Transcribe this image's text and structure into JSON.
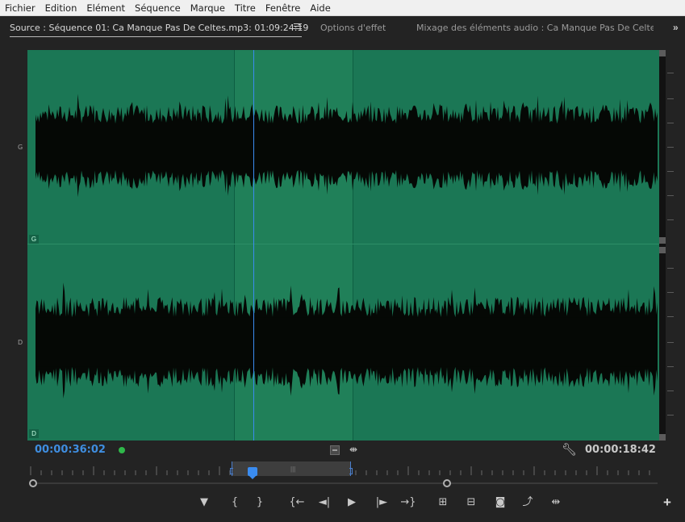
{
  "menubar": {
    "items": [
      "Fichier",
      "Edition",
      "Elément",
      "Séquence",
      "Marque",
      "Titre",
      "Fenêtre",
      "Aide"
    ]
  },
  "tabs": {
    "source": "Source : Séquence 01: Ca Manque Pas De Celtes.mp3: 01:09:24:19",
    "effects": "Options d'effet",
    "mixer": "Mixage des éléments audio : Ca Manque Pas De Celtes.m"
  },
  "channels": {
    "left_tag": "G",
    "right_tag": "D",
    "left_side_label": "G",
    "right_side_label": "D"
  },
  "timecodes": {
    "current": "00:00:36:02",
    "duration": "00:00:18:42"
  },
  "colors": {
    "waveform_bg": "#1b7755",
    "in_out_region": "#208059",
    "playhead": "#3a8cf0",
    "current_timecode": "#3f8ee0",
    "status_dot": "#2fb84a"
  },
  "icons": {
    "tab_menu": "hamburger-icon",
    "overflow": "double-chevron-right-icon",
    "wrench": "wrench-icon",
    "insert": "insert-icon",
    "drag": "drag-video-audio-icon"
  },
  "transport": {
    "add_marker": "▼",
    "mark_in": "{",
    "mark_out": "}",
    "go_to_in": "{←",
    "step_back": "◄|",
    "play": "▶",
    "step_forward": "|►",
    "go_to_out": "→}",
    "insert": "⊞",
    "overwrite": "⊟",
    "export_frame": "📷",
    "button_editor": "+"
  }
}
